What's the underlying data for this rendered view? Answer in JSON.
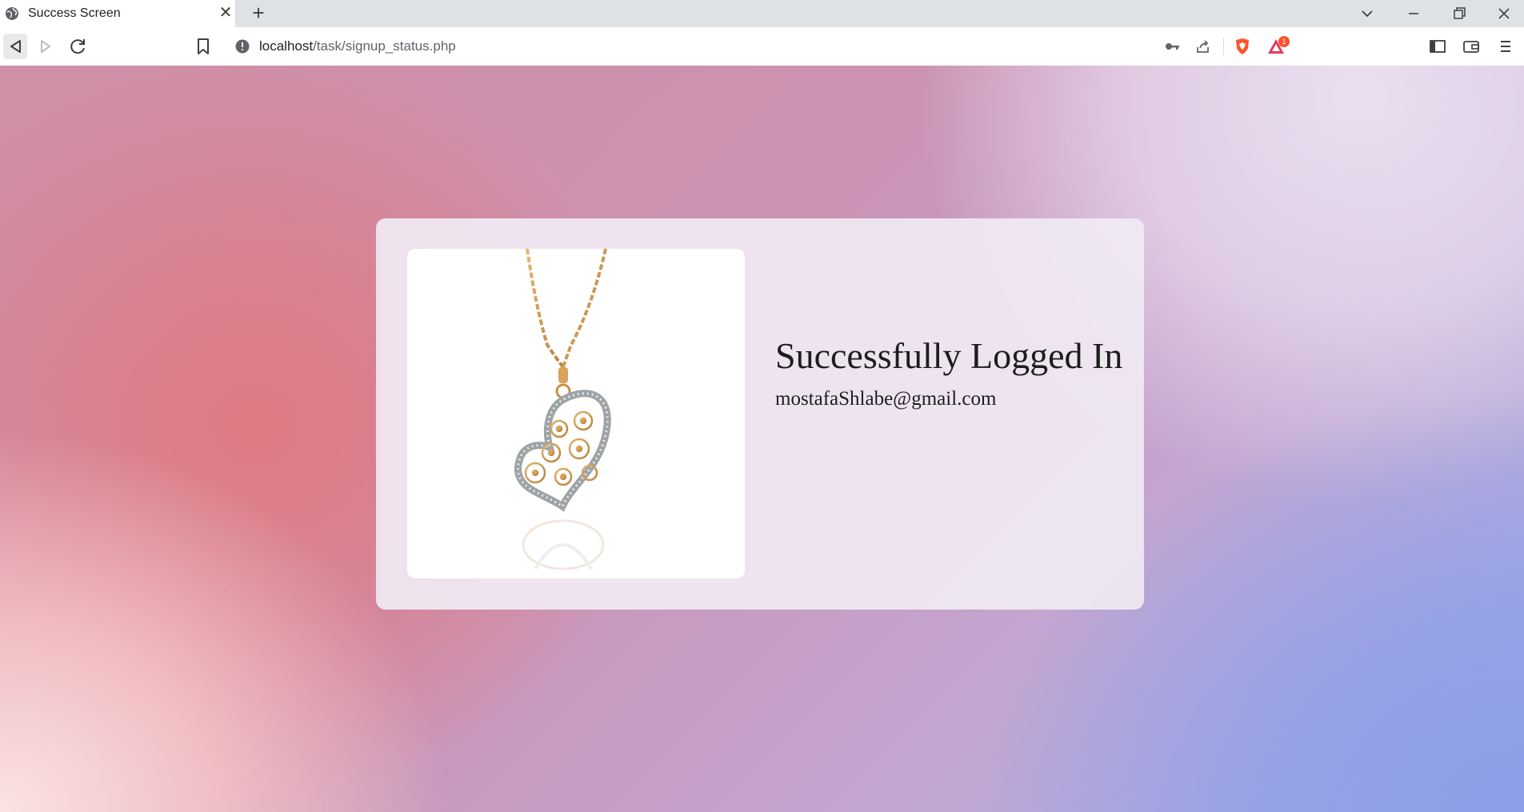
{
  "browser": {
    "tab": {
      "title": "Success Screen",
      "close_glyph": "✕"
    },
    "new_tab_glyph": "+",
    "url": {
      "host": "localhost",
      "path": "/task/signup_status.php"
    },
    "extensions_badge": "1"
  },
  "card": {
    "heading": "Successfully Logged In",
    "email": "mostafaShlabe@gmail.com",
    "image": {
      "subject": "gold heart pendant necklace with flowers"
    }
  },
  "colors": {
    "card_bg": "#f0eaf3",
    "text": "#1d1d1d",
    "brave_orange": "#fb542b"
  }
}
